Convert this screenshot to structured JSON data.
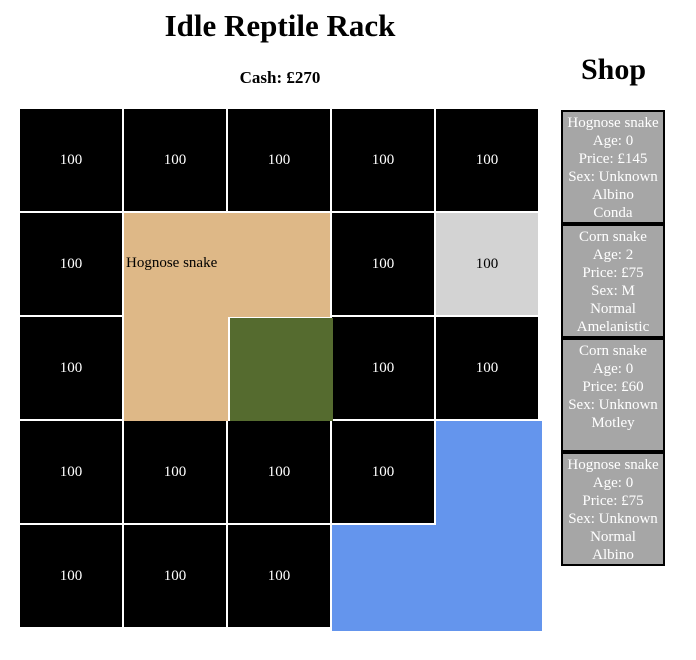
{
  "header": {
    "title": "Idle Reptile Rack",
    "cash": "Cash: £270"
  },
  "shop": {
    "title": "Shop",
    "items": [
      {
        "species": "Hognose snake",
        "age": "Age: 0",
        "price": "Price: £145",
        "sex": "Sex: Unknown",
        "morph_lines": [
          "Albino",
          "Conda"
        ]
      },
      {
        "species": "Corn snake",
        "age": "Age: 2",
        "price": "Price: £75",
        "sex": "Sex: M",
        "morph_lines": [
          "Normal",
          "Amelanistic"
        ]
      },
      {
        "species": "Corn snake",
        "age": "Age: 0",
        "price": "Price: £60",
        "sex": "Sex: Unknown",
        "morph_lines": [
          "Motley"
        ]
      },
      {
        "species": "Hognose snake",
        "age": "Age: 0",
        "price": "Price: £75",
        "sex": "Sex: Unknown",
        "morph_lines": [
          "Normal",
          "Albino"
        ]
      }
    ]
  },
  "rack": {
    "empty_value": "100",
    "occupant_label": "Hognose snake",
    "cells": [
      "100",
      "100",
      "100",
      "100",
      "100",
      "100",
      "100",
      "100",
      "100",
      "100",
      "100",
      "100",
      "100",
      "100",
      "100",
      "100",
      "100",
      "100"
    ]
  },
  "colors": {
    "empty_cell": "#000000",
    "light_cell": "#d3d3d3",
    "hognose_enclosure": "#deb887",
    "moss_tile": "#556b2f",
    "blue_enclosure": "#6495ed",
    "shop_card": "#a6a6a6"
  }
}
